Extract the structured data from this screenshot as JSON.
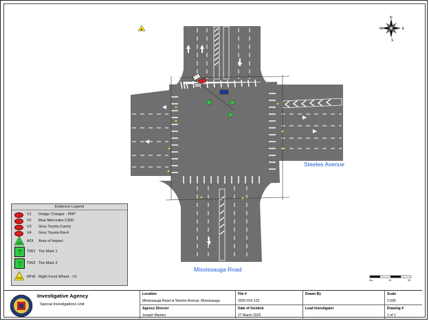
{
  "streets": {
    "east_west": "Steeles Avenue",
    "north_south": "Mississauga Road"
  },
  "legend": {
    "title": "Evidence Legend",
    "items": [
      {
        "symbol": "red-ellipse",
        "code": "V1",
        "desc": "Dodge Charger - PRP"
      },
      {
        "symbol": "red-ellipse",
        "code": "V2",
        "desc": "Blue Mercedes C300"
      },
      {
        "symbol": "red-ellipse",
        "code": "V3",
        "desc": "Grey Toyota Camry"
      },
      {
        "symbol": "red-ellipse",
        "code": "V4",
        "desc": "Grey Toyota Rav4"
      },
      {
        "symbol": "green-triangle",
        "code": "AOI",
        "desc": "Area of Impact",
        "glyph": "AOI"
      },
      {
        "symbol": "green-square",
        "code": "TM/1",
        "desc": "Tire Mark 1",
        "glyph": "TM\n-1"
      },
      {
        "symbol": "green-square",
        "code": "TM/2",
        "desc": "Tire Mark 2",
        "glyph": "TM\n-2"
      },
      {
        "symbol": "yellow-triangle",
        "code": "RFW",
        "desc": "Right Front Wheel - V1",
        "glyph": "RFW"
      }
    ]
  },
  "scale_bar": {
    "labels": [
      "0m",
      "10",
      "20"
    ]
  },
  "title_block": {
    "agency": "Investigative Agency",
    "unit": "Special Investigations Unit",
    "location_label": "Location",
    "location": "Mississauga Road at Steeles Avenue, Mississauga",
    "file_label": "File #",
    "file": "2025-OVI-122",
    "drawn_by_label": "Drawn By",
    "drawn_by": "",
    "scale_label": "Scale",
    "scale": "1:600",
    "director_label": "Agency Director",
    "director": "Joseph Martino",
    "date_label": "Date of Incident",
    "date": "27 March 2025",
    "lead_label": "Lead Investigator",
    "lead": "",
    "drawing_label": "Drawing #",
    "drawing": "1 of 1"
  },
  "compass": {
    "letters": [
      "N",
      "E",
      "S",
      "W"
    ]
  },
  "colors": {
    "road": "#6f6f6f",
    "curb": "#5a5a5a",
    "marker_red": "#d3211f",
    "marker_green": "#2ecc40",
    "marker_yellow": "#f4e11a",
    "street_label": "#1b5fd6"
  }
}
